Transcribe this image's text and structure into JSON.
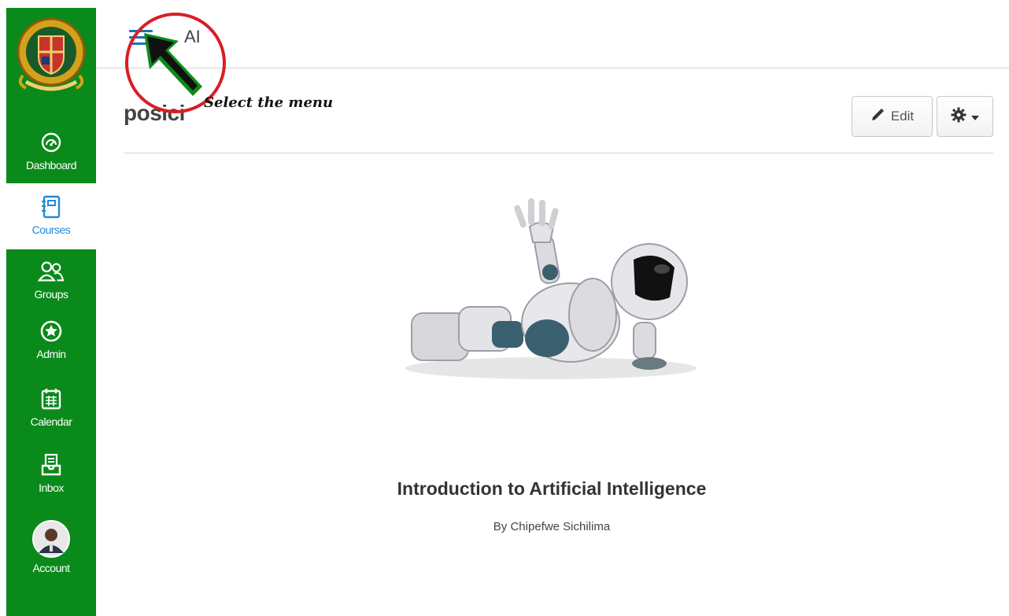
{
  "sidebar": {
    "logo_icon": "university-crest-icon",
    "items": [
      {
        "label": "Dashboard",
        "icon": "dashboard-gauge-icon"
      },
      {
        "label": "Courses",
        "icon": "courses-book-icon"
      },
      {
        "label": "Groups",
        "icon": "groups-people-icon"
      },
      {
        "label": "Admin",
        "icon": "admin-shield-star-icon"
      },
      {
        "label": "Calendar",
        "icon": "calendar-icon"
      },
      {
        "label": "Inbox",
        "icon": "inbox-icon"
      },
      {
        "label": "Account",
        "icon": "account-avatar"
      }
    ],
    "active": "Courses",
    "colors": {
      "background": "#0a8a1a",
      "active_text": "#1f8bd8",
      "text": "#ffffff"
    }
  },
  "header": {
    "menu_icon": "hamburger-menu-icon",
    "breadcrumb": "AI"
  },
  "page": {
    "title": "posici",
    "edit_label": "Edit",
    "edit_icon": "pencil-icon",
    "settings_icon": "gear-icon"
  },
  "annotation": {
    "text": "Select the menu",
    "color": "#d81e25",
    "arrow_color": "#0f8a1a"
  },
  "content": {
    "image": "robot-lying-illustration",
    "course_title": "Introduction to Artificial Intelligence",
    "author": "By Chipefwe Sichilima"
  }
}
